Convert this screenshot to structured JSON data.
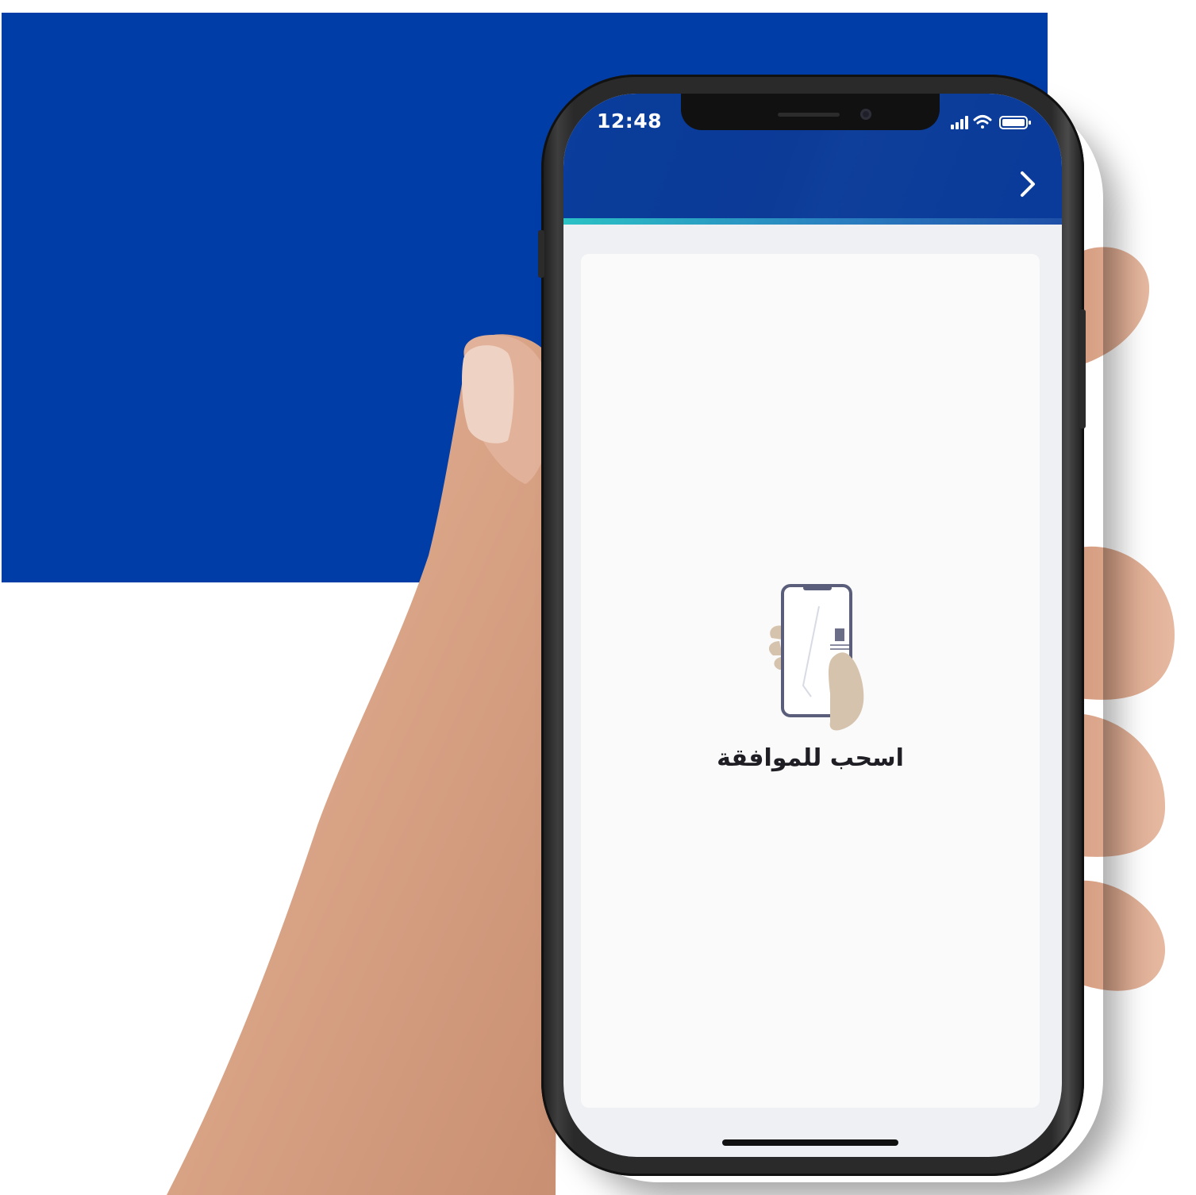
{
  "status_bar": {
    "time": "12:48",
    "icons": [
      "cellular-signal-icon",
      "wifi-icon",
      "battery-icon"
    ]
  },
  "header": {
    "back_icon": "chevron-right-icon"
  },
  "content": {
    "illustration": "hand-holding-phone-icon",
    "swipe_label": "اسحب للموافقة"
  },
  "colors": {
    "background_panel": "#003da6",
    "header": "#0b3a97",
    "accent_stripe": "#2bc2c5",
    "card": "#fafafa",
    "screen_bg": "#eef0f4",
    "label_text": "#1e1e24"
  }
}
